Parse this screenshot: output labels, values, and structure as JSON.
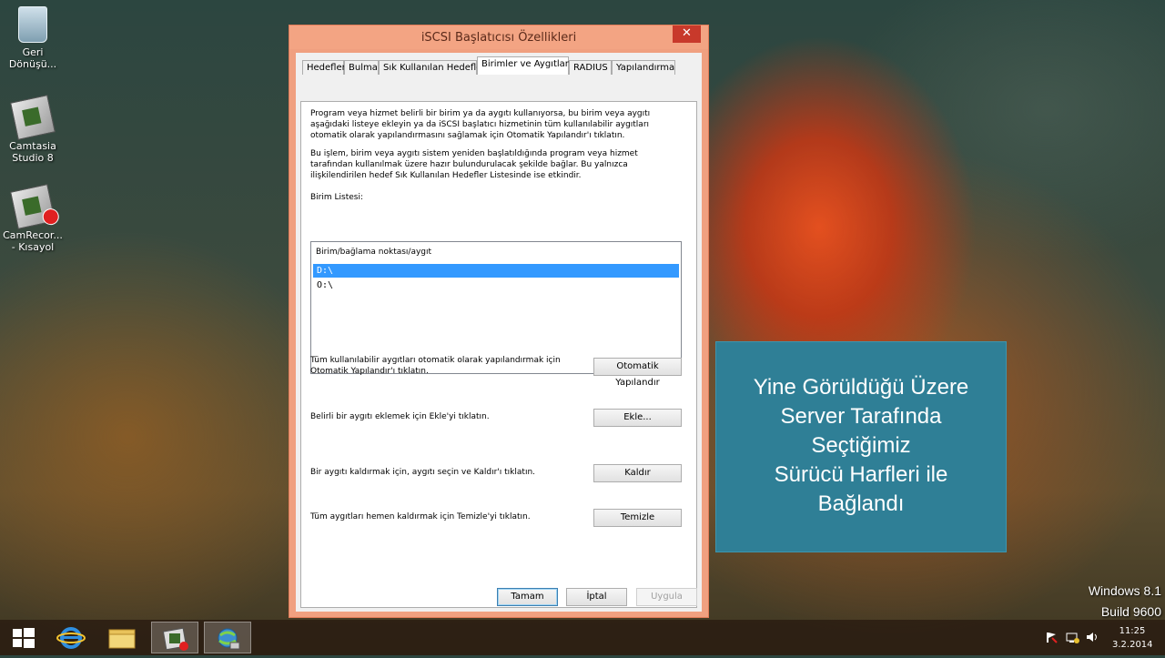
{
  "desktop": {
    "icons": [
      {
        "label_line1": "Geri",
        "label_line2": "Dönüşü..."
      },
      {
        "label_line1": "Camtasia",
        "label_line2": "Studio 8"
      },
      {
        "label_line1": "CamRecor...",
        "label_line2": "- Kısayol"
      }
    ]
  },
  "dialog": {
    "title": "iSCSI Başlatıcısı Özellikleri",
    "close_glyph": "✕",
    "tabs": [
      "Hedefler",
      "Bulma",
      "Sık Kullanılan Hedefler",
      "Birimler ve Aygıtlar",
      "RADIUS",
      "Yapılandırma"
    ],
    "intro_text_1": [
      "Program veya hizmet belirli bir birim ya da aygıtı kullanıyorsa, bu birim veya aygıtı",
      "aşağıdaki listeye ekleyin ya da iSCSI başlatıcı hizmetinin tüm kullanılabilir aygıtları",
      "otomatik olarak yapılandırmasını sağlamak için Otomatik Yapılandır'ı tıklatın."
    ],
    "intro_text_2": [
      "Bu işlem, birim veya aygıtı sistem yeniden başlatıldığında program veya hizmet",
      "tarafından kullanılmak üzere hazır bulundurulacak şekilde bağlar.  Bu yalnızca",
      "ilişkilendirilen hedef Sık Kullanılan Hedefler Listesinde ise etkindir."
    ],
    "list_label": "Birim Listesi:",
    "list_header": "Birim/bağlama noktası/aygıt",
    "list_items": [
      "D:\\",
      "O:\\"
    ],
    "auto_text": [
      "Tüm kullanılabilir aygıtları otomatik olarak yapılandırmak için",
      "Otomatik Yapılandır'ı tıklatın."
    ],
    "auto_button": "Otomatik Yapılandır",
    "add_text": "Belirli bir aygıtı eklemek için Ekle'yi tıklatın.",
    "add_button": "Ekle...",
    "remove_text": "Bir aygıtı kaldırmak için, aygıtı seçin ve Kaldır'ı tıklatın.",
    "remove_button": "Kaldır",
    "clear_text": "Tüm aygıtları hemen kaldırmak için Temizle'yi tıklatın.",
    "clear_button": "Temizle",
    "ok_button": "Tamam",
    "cancel_button": "İptal",
    "apply_button": "Uygula"
  },
  "overlay": {
    "lines": [
      "Yine Görüldüğü Üzere",
      "Server Tarafında",
      "Seçtiğimiz",
      "Sürücü Harfleri ile",
      "Bağlandı"
    ]
  },
  "watermark": {
    "line1": "Windows 8.1",
    "line2": "Build 9600"
  },
  "taskbar": {
    "clock_time": "11:25",
    "clock_date": "3.2.2014"
  },
  "colors": {
    "overlay_bg": "#2f7f96",
    "dialog_frame": "#f0a080",
    "close_button": "#c8392b",
    "selection": "#3399ff"
  }
}
